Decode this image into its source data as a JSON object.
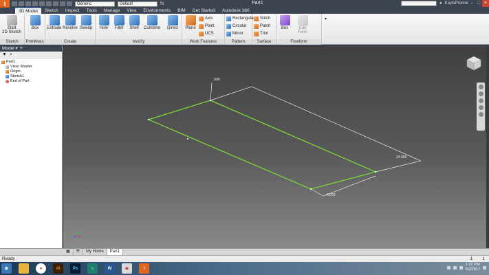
{
  "titlebar": {
    "material_combo": "Generic",
    "appearance_combo": "Default",
    "fx_label": "fx",
    "document_title": "Part1",
    "user_name": "KaylaProctor"
  },
  "tabs": [
    "3D Model",
    "Sketch",
    "Inspect",
    "Tools",
    "Manage",
    "View",
    "Environments",
    "BIM",
    "Get Started",
    "Autodesk 360"
  ],
  "ribbon": {
    "sketch": {
      "button": "Start\n2D Sketch",
      "label": "Sketch"
    },
    "primitives": {
      "button": "Box",
      "label": "Primitives"
    },
    "create": {
      "extrude": "Extrude",
      "revolve": "Revolve",
      "sweep": "Sweep",
      "label": "Create"
    },
    "modify": {
      "hole": "Hole",
      "fillet": "Fillet",
      "shell": "Shell",
      "combine": "Combine",
      "direct": "Direct",
      "label": "Modify"
    },
    "work_features": {
      "plane": "Plane",
      "axis": "Axis",
      "point": "Point",
      "ucs": "UCS",
      "label": "Work Features"
    },
    "pattern": {
      "rectangular": "Rectangular",
      "circular": "Circular",
      "mirror": "Mirror",
      "label": "Pattern"
    },
    "surface": {
      "stitch": "Stitch",
      "patch": "Patch",
      "trim": "Trim",
      "label": "Surface"
    },
    "freeform": {
      "box": "Box",
      "edit_form": "Edit\nForm",
      "label": "Freeform"
    }
  },
  "browser": {
    "title": "Model",
    "items": [
      {
        "label": "Part1",
        "level": 0,
        "icon": "part-icon"
      },
      {
        "label": "View: Master",
        "level": 1,
        "icon": "view-icon"
      },
      {
        "label": "Origin",
        "level": 1,
        "icon": "folder-icon"
      },
      {
        "label": "Sketch1",
        "level": 1,
        "icon": "sketch-icon"
      },
      {
        "label": "End of Part",
        "level": 1,
        "icon": "end-of-part-icon"
      }
    ]
  },
  "viewport": {
    "dim_small": ".500",
    "dim_length": "24.000",
    "dim_width": "6.000"
  },
  "doctabs": {
    "home": "My Home",
    "part": "Part1"
  },
  "status": {
    "text": "Ready",
    "num1": "1",
    "num2": "1"
  },
  "taskbar": {
    "time": "1:22 PM",
    "date": "5/2/2017"
  },
  "colors": {
    "sketch_line": "#7bd638",
    "accent": "#e2661f"
  }
}
